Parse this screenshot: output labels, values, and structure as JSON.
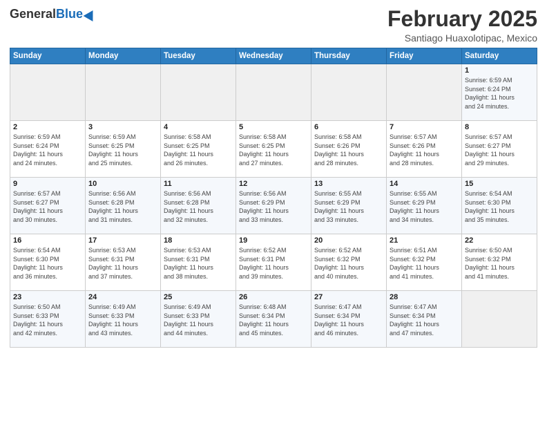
{
  "header": {
    "title": "February 2025",
    "location": "Santiago Huaxolotipac, Mexico"
  },
  "calendar": {
    "columns": [
      "Sunday",
      "Monday",
      "Tuesday",
      "Wednesday",
      "Thursday",
      "Friday",
      "Saturday"
    ],
    "rows": [
      [
        {
          "day": "",
          "info": ""
        },
        {
          "day": "",
          "info": ""
        },
        {
          "day": "",
          "info": ""
        },
        {
          "day": "",
          "info": ""
        },
        {
          "day": "",
          "info": ""
        },
        {
          "day": "",
          "info": ""
        },
        {
          "day": "1",
          "info": "Sunrise: 6:59 AM\nSunset: 6:24 PM\nDaylight: 11 hours\nand 24 minutes."
        }
      ],
      [
        {
          "day": "2",
          "info": "Sunrise: 6:59 AM\nSunset: 6:24 PM\nDaylight: 11 hours\nand 24 minutes."
        },
        {
          "day": "3",
          "info": "Sunrise: 6:59 AM\nSunset: 6:25 PM\nDaylight: 11 hours\nand 25 minutes."
        },
        {
          "day": "4",
          "info": "Sunrise: 6:58 AM\nSunset: 6:25 PM\nDaylight: 11 hours\nand 26 minutes."
        },
        {
          "day": "5",
          "info": "Sunrise: 6:58 AM\nSunset: 6:25 PM\nDaylight: 11 hours\nand 27 minutes."
        },
        {
          "day": "6",
          "info": "Sunrise: 6:58 AM\nSunset: 6:26 PM\nDaylight: 11 hours\nand 28 minutes."
        },
        {
          "day": "7",
          "info": "Sunrise: 6:57 AM\nSunset: 6:26 PM\nDaylight: 11 hours\nand 28 minutes."
        },
        {
          "day": "8",
          "info": "Sunrise: 6:57 AM\nSunset: 6:27 PM\nDaylight: 11 hours\nand 29 minutes."
        }
      ],
      [
        {
          "day": "9",
          "info": "Sunrise: 6:57 AM\nSunset: 6:27 PM\nDaylight: 11 hours\nand 30 minutes."
        },
        {
          "day": "10",
          "info": "Sunrise: 6:56 AM\nSunset: 6:28 PM\nDaylight: 11 hours\nand 31 minutes."
        },
        {
          "day": "11",
          "info": "Sunrise: 6:56 AM\nSunset: 6:28 PM\nDaylight: 11 hours\nand 32 minutes."
        },
        {
          "day": "12",
          "info": "Sunrise: 6:56 AM\nSunset: 6:29 PM\nDaylight: 11 hours\nand 33 minutes."
        },
        {
          "day": "13",
          "info": "Sunrise: 6:55 AM\nSunset: 6:29 PM\nDaylight: 11 hours\nand 33 minutes."
        },
        {
          "day": "14",
          "info": "Sunrise: 6:55 AM\nSunset: 6:29 PM\nDaylight: 11 hours\nand 34 minutes."
        },
        {
          "day": "15",
          "info": "Sunrise: 6:54 AM\nSunset: 6:30 PM\nDaylight: 11 hours\nand 35 minutes."
        }
      ],
      [
        {
          "day": "16",
          "info": "Sunrise: 6:54 AM\nSunset: 6:30 PM\nDaylight: 11 hours\nand 36 minutes."
        },
        {
          "day": "17",
          "info": "Sunrise: 6:53 AM\nSunset: 6:31 PM\nDaylight: 11 hours\nand 37 minutes."
        },
        {
          "day": "18",
          "info": "Sunrise: 6:53 AM\nSunset: 6:31 PM\nDaylight: 11 hours\nand 38 minutes."
        },
        {
          "day": "19",
          "info": "Sunrise: 6:52 AM\nSunset: 6:31 PM\nDaylight: 11 hours\nand 39 minutes."
        },
        {
          "day": "20",
          "info": "Sunrise: 6:52 AM\nSunset: 6:32 PM\nDaylight: 11 hours\nand 40 minutes."
        },
        {
          "day": "21",
          "info": "Sunrise: 6:51 AM\nSunset: 6:32 PM\nDaylight: 11 hours\nand 41 minutes."
        },
        {
          "day": "22",
          "info": "Sunrise: 6:50 AM\nSunset: 6:32 PM\nDaylight: 11 hours\nand 41 minutes."
        }
      ],
      [
        {
          "day": "23",
          "info": "Sunrise: 6:50 AM\nSunset: 6:33 PM\nDaylight: 11 hours\nand 42 minutes."
        },
        {
          "day": "24",
          "info": "Sunrise: 6:49 AM\nSunset: 6:33 PM\nDaylight: 11 hours\nand 43 minutes."
        },
        {
          "day": "25",
          "info": "Sunrise: 6:49 AM\nSunset: 6:33 PM\nDaylight: 11 hours\nand 44 minutes."
        },
        {
          "day": "26",
          "info": "Sunrise: 6:48 AM\nSunset: 6:34 PM\nDaylight: 11 hours\nand 45 minutes."
        },
        {
          "day": "27",
          "info": "Sunrise: 6:47 AM\nSunset: 6:34 PM\nDaylight: 11 hours\nand 46 minutes."
        },
        {
          "day": "28",
          "info": "Sunrise: 6:47 AM\nSunset: 6:34 PM\nDaylight: 11 hours\nand 47 minutes."
        },
        {
          "day": "",
          "info": ""
        }
      ]
    ]
  }
}
